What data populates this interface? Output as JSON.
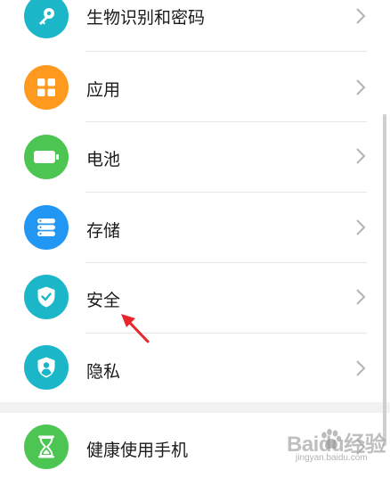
{
  "settings": {
    "items": [
      {
        "label": "生物识别和密码",
        "icon": "key-icon",
        "color": "#1BB7C9"
      },
      {
        "label": "应用",
        "icon": "apps-grid-icon",
        "color": "#FF9A1F"
      },
      {
        "label": "电池",
        "icon": "battery-icon",
        "color": "#4CC553"
      },
      {
        "label": "存储",
        "icon": "storage-icon",
        "color": "#2196F3"
      },
      {
        "label": "安全",
        "icon": "shield-check-icon",
        "color": "#1BB7C9"
      },
      {
        "label": "隐私",
        "icon": "privacy-shield-icon",
        "color": "#1BB7C9"
      },
      {
        "label": "健康使用手机",
        "icon": "hourglass-icon",
        "color": "#4CC553"
      }
    ],
    "chevron_icon": "chevron-right-icon"
  },
  "annotation": {
    "icon": "red-arrow-icon",
    "color": "#E8252B"
  },
  "watermark": {
    "brand": "Baidu经验",
    "domain": "jingyan.baidu.com"
  }
}
